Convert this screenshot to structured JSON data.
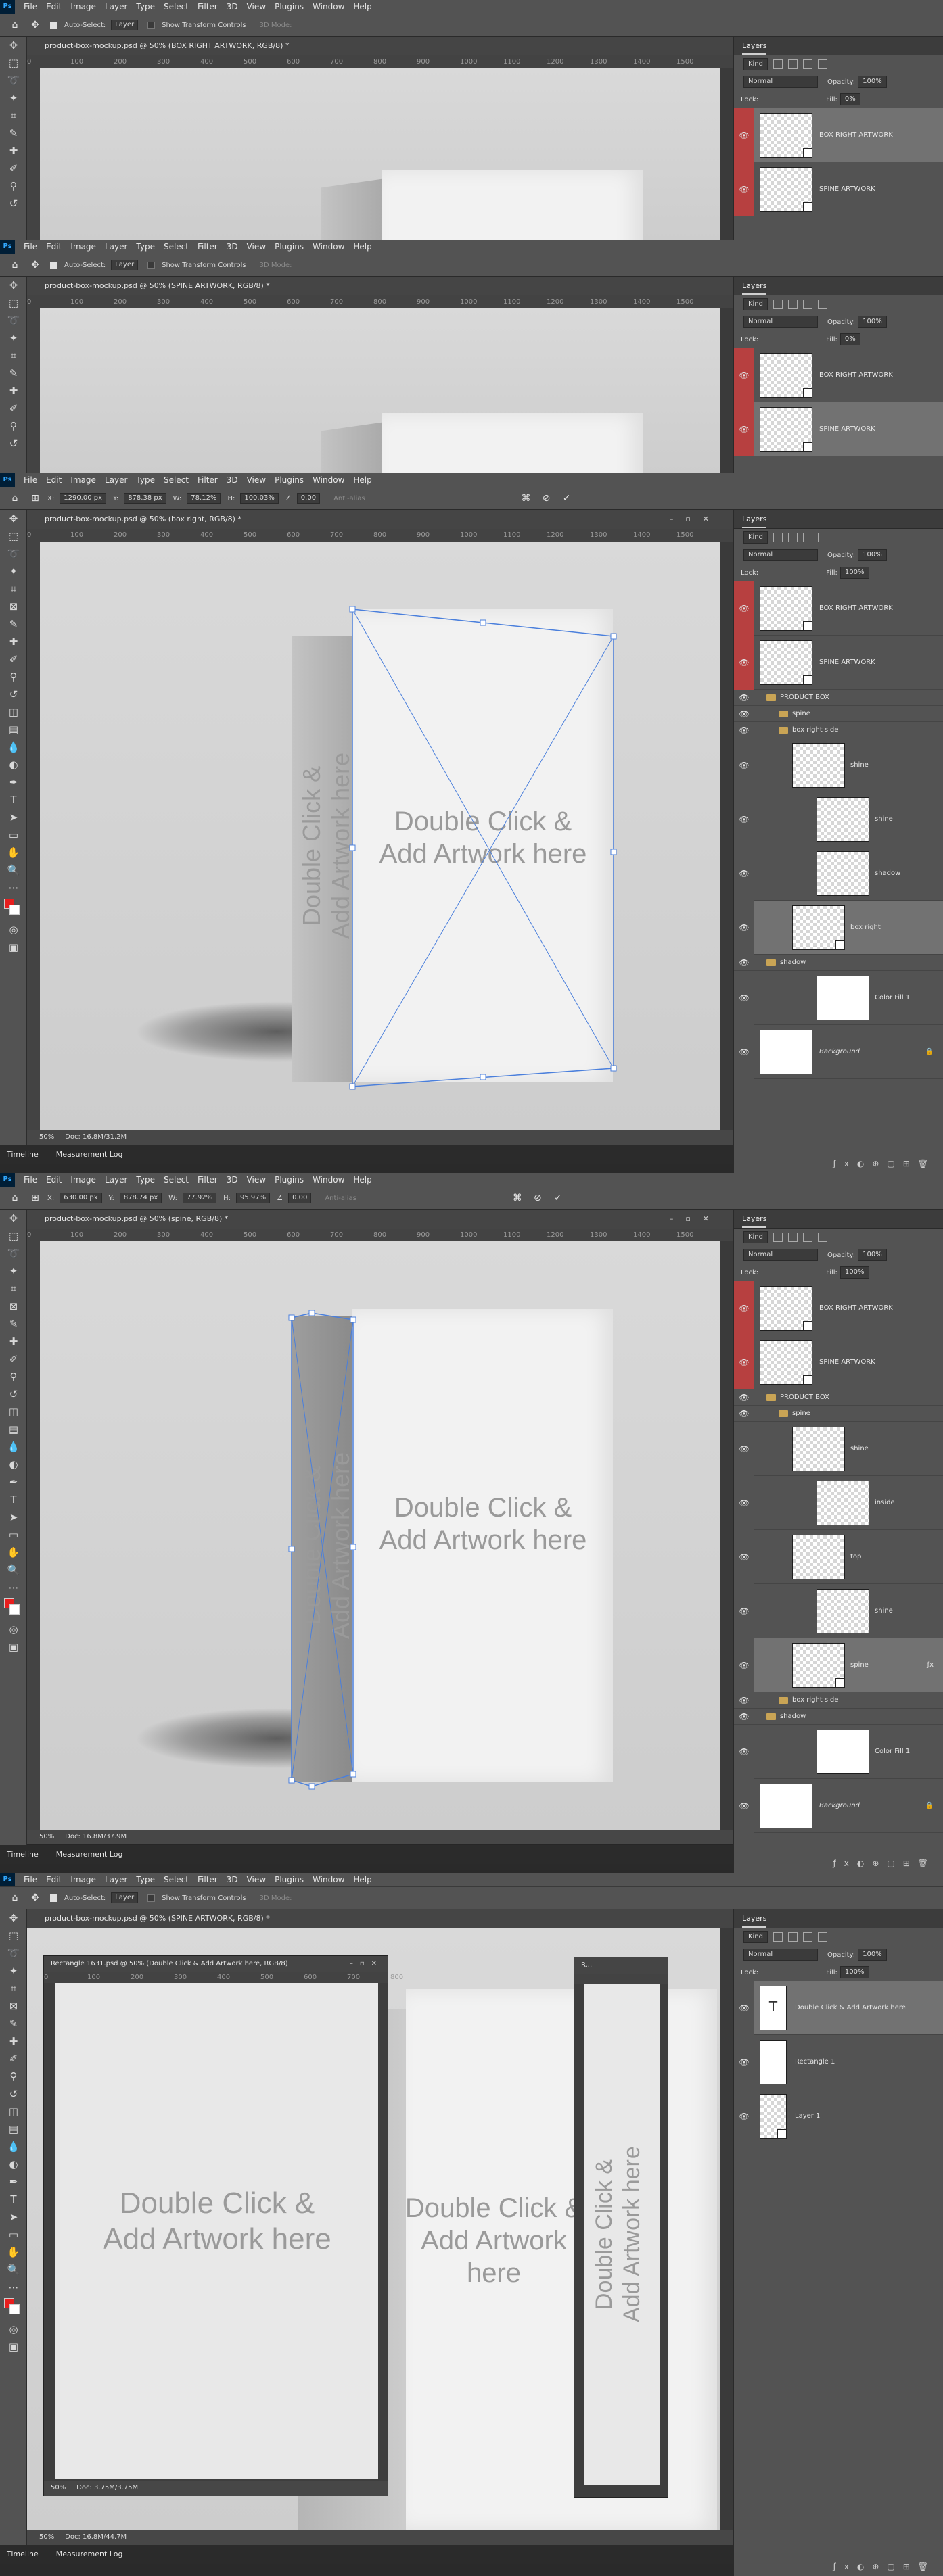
{
  "menu": [
    "File",
    "Edit",
    "Image",
    "Layer",
    "Type",
    "Select",
    "Filter",
    "3D",
    "View",
    "Plugins",
    "Window",
    "Help"
  ],
  "ps_logo": "Ps",
  "options_move": {
    "auto_select": "Auto-Select:",
    "auto_select_value": "Layer",
    "transform": "Show Transform Controls",
    "mode": "3D Mode:"
  },
  "tabs": [
    "product-box-mockup.psd @ 50% (BOX RIGHT ARTWORK, RGB/8) *",
    "product-box-mockup.psd @ 50% (SPINE ARTWORK, RGB/8) *",
    "product-box-mockup.psd @ 50% (box right, RGB/8) *",
    "product-box-mockup.psd @ 50% (spine, RGB/8) *",
    "product-box-mockup.psd @ 50% (SPINE ARTWORK, RGB/8) *"
  ],
  "ruler_top": [
    "0",
    "100",
    "200",
    "300",
    "400",
    "500",
    "600",
    "700",
    "800",
    "900",
    "1000",
    "1100",
    "1200",
    "1300",
    "1400",
    "1500",
    "1600"
  ],
  "ruler_left": [
    "0",
    "50",
    "100",
    "150",
    "200",
    "250",
    "300",
    "350",
    "400",
    "450",
    "500"
  ],
  "transform_1": {
    "x": "1290.00 px",
    "y": "878.38 px",
    "w": "78.12%",
    "h": "100.03%",
    "angle": "0.00",
    "interp": "Anti-alias"
  },
  "transform_2": {
    "x": "630.00 px",
    "y": "878.74 px",
    "w": "77.92%",
    "h": "95.97%",
    "angle": "0.00",
    "interp": "Anti-alias"
  },
  "status": {
    "zoom": "50%",
    "doc_a": "Doc: 16.8M/31.2M",
    "doc_b": "Doc: 16.8M/37.9M",
    "sub_doc_a": "Doc: 3.75M/3.75M",
    "sub_doc_b": "Doc: 16.8M/44.7M"
  },
  "timeline": {
    "a": "Timeline",
    "b": "Measurement Log"
  },
  "layers_panel": {
    "tab": "Layers",
    "kind": "Kind",
    "blend": "Normal",
    "opacity_label": "Opacity:",
    "opacity": "100%",
    "lock_label": "Lock:",
    "fill_label": "Fill:",
    "fill": "100%",
    "fill_zero": "0%"
  },
  "layers": {
    "box_right_art": "BOX RIGHT ARTWORK",
    "spine_art": "SPINE ARTWORK",
    "product_box": "PRODUCT BOX",
    "spine": "spine",
    "box_right_side": "box right side",
    "shine": "shine",
    "shadow": "shadow",
    "box_right": "box right",
    "color_fill": "Color Fill 1",
    "background": "Background",
    "inside": "inside",
    "top": "top",
    "dbl_layer": "Double Click & Add Artwork here",
    "rect": "Rectangle 1",
    "layer1": "Layer 1"
  },
  "artwork": {
    "line1": "Double Click &",
    "line2": "Add Artwork here"
  },
  "subdoc1": "Rectangle 1631.psd @ 50% (Double Click & Add Artwork here, RGB/8)",
  "subdoc2": "R...",
  "colors": {
    "accent": "#b74040",
    "selection": "#4a7fdc",
    "fg_swatch": "#e81e1e"
  },
  "icons": [
    "move-icon",
    "marquee-icon",
    "lasso-icon",
    "crop-icon",
    "eyedropper-icon",
    "brush-icon",
    "stamp-icon",
    "eraser-icon",
    "gradient-icon",
    "pen-icon",
    "type-icon",
    "path-select-icon",
    "shape-icon",
    "hand-icon",
    "zoom-icon",
    "eye-icon",
    "folder-icon",
    "lock-icon",
    "fx-icon",
    "trash-icon",
    "check-icon",
    "cancel-icon",
    "warp-icon"
  ]
}
